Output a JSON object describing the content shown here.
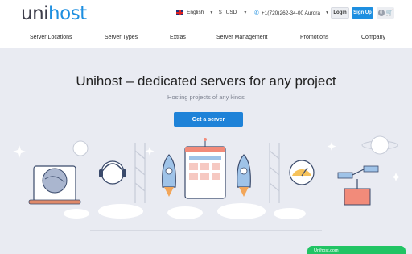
{
  "brand": {
    "logo_part1": "uni",
    "logo_part2": "host"
  },
  "topbar": {
    "language": "English",
    "currency_symbol": "$",
    "currency": "USD",
    "phone": "+1(720)262-34-00 Aurora",
    "login_label": "Login",
    "signup_label": "Sign Up",
    "cart_count": "0"
  },
  "nav": {
    "items": [
      "Server Locations",
      "Server Types",
      "Extras",
      "Server Management",
      "Promotions",
      "Company"
    ]
  },
  "hero": {
    "title": "Unihost – dedicated servers for any project",
    "subtitle": "Hosting projects of any kinds",
    "cta_label": "Get a server"
  },
  "chat": {
    "label": "Unihost.com"
  },
  "colors": {
    "accent": "#1e8fe0",
    "hero_bg": "#e9ebf2",
    "chat": "#21c464"
  },
  "icons": [
    "uk-flag-icon",
    "phone-icon",
    "cart-icon",
    "caret-down-icon"
  ]
}
